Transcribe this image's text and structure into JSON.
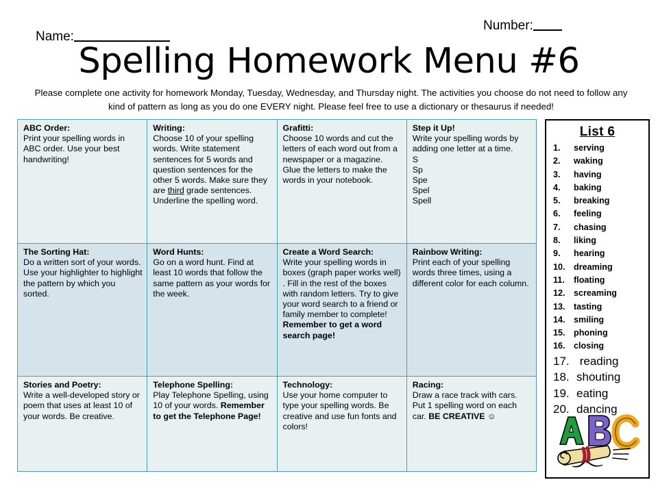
{
  "header": {
    "name_label": "Name:",
    "number_label": "Number:",
    "title": "Spelling Homework Menu #6",
    "instructions": "Please complete one activity for homework Monday, Tuesday, Wednesday, and Thursday night.    The activities you choose do not need to follow any kind of pattern as long as you do one EVERY night.  Please feel free to use a dictionary or thesaurus if needed!"
  },
  "menu": {
    "rows": [
      {
        "cells": [
          {
            "title": "ABC Order:",
            "body": "Print your spelling words in ABC order.  Use your best handwriting!"
          },
          {
            "title": "Writing:",
            "body_before": "Choose 10 of your spelling words.  Write statement sentences for 5 words and question sentences for the other 5 words.  Make sure they are ",
            "underlined": "third",
            "body_after": " grade sentences. Underline the spelling word."
          },
          {
            "title": "Grafitti:",
            "body": "Choose 10 words and cut the letters of each word out from a newspaper or a magazine.  Glue the letters to make the words in your notebook."
          },
          {
            "title": "Step it Up!",
            "body": "Write your spelling words by adding one letter at a time.",
            "ladder": [
              "S",
              "Sp",
              "Spe",
              "Spel",
              "Spell"
            ]
          }
        ]
      },
      {
        "cells": [
          {
            "title": "The Sorting Hat:",
            "body": "Do a written sort of your words.  Use your highlighter to highlight the pattern by which you sorted."
          },
          {
            "title": "Word Hunts:",
            "body": "Go on a word hunt.  Find at least 10  words that follow the same pattern as your words for the week."
          },
          {
            "title": "Create a Word Search:",
            "body": "Write your spelling words in boxes (graph paper works well) . Fill in the rest of the boxes with random letters. Try to give your word search to a friend or family member to complete!",
            "bold_tail": "Remember to get a word search page!"
          },
          {
            "title": "Rainbow Writing:",
            "body": "Print each of your spelling words three times, using a different color for each column."
          }
        ]
      },
      {
        "cells": [
          {
            "title": "Stories and Poetry:",
            "body": "Write a well-developed story or poem that uses at least 10 of your words.  Be creative."
          },
          {
            "title": "Telephone Spelling:",
            "body": "Play Telephone Spelling, using 10  of your words.",
            "bold_tail": "Remember to get the Telephone Page!"
          },
          {
            "title": "Technology:",
            "body": "Use your home computer to type your spelling words. Be creative and use fun fonts and colors!"
          },
          {
            "title": "Racing:",
            "body": "Draw a race track with cars. Put 1 spelling word on each car.",
            "bold_tail": "BE CREATIVE ☺"
          }
        ]
      }
    ]
  },
  "word_list": {
    "title": "List 6",
    "items": [
      {
        "num": "1.",
        "word": "serving"
      },
      {
        "num": "2.",
        "word": "waking"
      },
      {
        "num": "3.",
        "word": "having"
      },
      {
        "num": "4.",
        "word": "baking"
      },
      {
        "num": "5.",
        "word": "breaking"
      },
      {
        "num": "6.",
        "word": "feeling"
      },
      {
        "num": "7.",
        "word": "chasing"
      },
      {
        "num": "8.",
        "word": "liking"
      },
      {
        "num": "9.",
        "word": "hearing"
      },
      {
        "num": "10.",
        "word": "dreaming"
      },
      {
        "num": "11.",
        "word": "floating"
      },
      {
        "num": "12.",
        "word": "screaming"
      },
      {
        "num": "13.",
        "word": "tasting"
      },
      {
        "num": "14.",
        "word": "smiling"
      },
      {
        "num": "15.",
        "word": "phoning"
      },
      {
        "num": "16.",
        "word": "closing"
      },
      {
        "num": "17.",
        "word": " reading"
      },
      {
        "num": "18.",
        "word": "shouting"
      },
      {
        "num": "19.",
        "word": "eating"
      },
      {
        "num": "20.",
        "word": "dancing"
      }
    ],
    "large_from_index": 16
  },
  "clipart": {
    "letters": [
      "A",
      "B",
      "C"
    ],
    "letter_colors": [
      "#1e9e3e",
      "#7a62c8",
      "#efa81e"
    ],
    "scroll_color": "#f0dea0",
    "ribbon_color": "#9e2030"
  },
  "colors": {
    "table_border": "#4c9caf",
    "row_light": "#e9f0f2",
    "row_dark": "#d4e4ea",
    "panel_border": "#000000"
  }
}
